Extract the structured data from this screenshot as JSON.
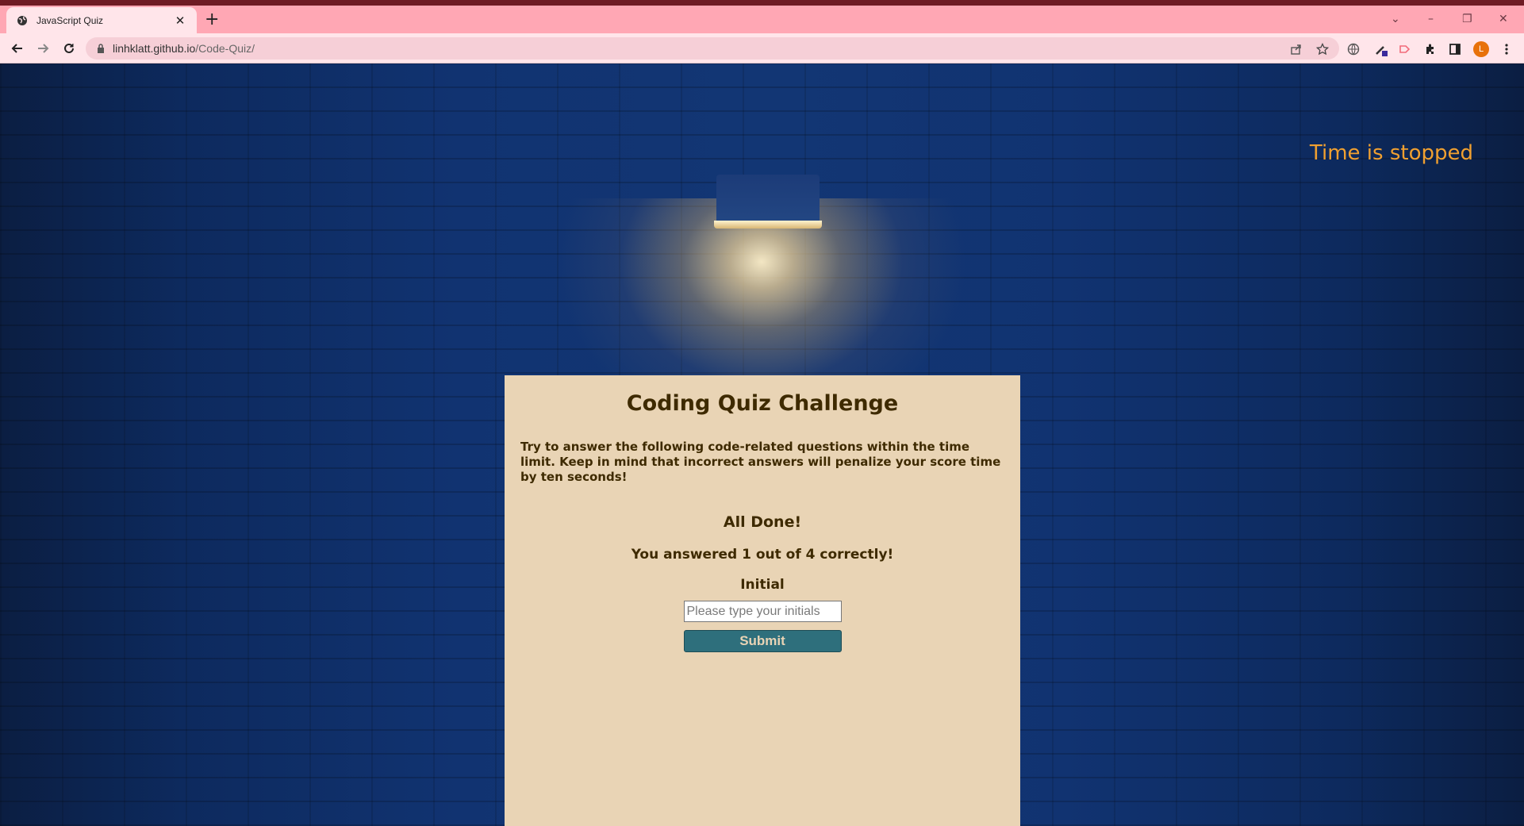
{
  "browser": {
    "tab_title": "JavaScript Quiz",
    "tab_close": "✕",
    "new_tab": "+",
    "url_domain": "linhklatt.github.io",
    "url_path": "/Code-Quiz/",
    "avatar_letter": "L",
    "window_controls": [
      "⌄",
      "–",
      "❐",
      "✕"
    ]
  },
  "page": {
    "timer": "Time is stopped",
    "card": {
      "title": "Coding Quiz Challenge",
      "intro": "Try to answer the following code-related questions within the time limit. Keep in mind that incorrect answers will penalize your score time by ten seconds!",
      "done": "All Done!",
      "score": "You answered 1 out of 4 correctly!",
      "initial_label": "Initial",
      "initial_placeholder": "Please type your initials",
      "submit_label": "Submit"
    }
  },
  "colors": {
    "tab_bar": "#ffa7b4",
    "toolbar": "#ffe5ea",
    "card": "#e9d4b5",
    "card_text": "#3e2a00",
    "submit": "#2e6f7c",
    "timer": "#f0a030",
    "avatar": "#e8710a"
  }
}
